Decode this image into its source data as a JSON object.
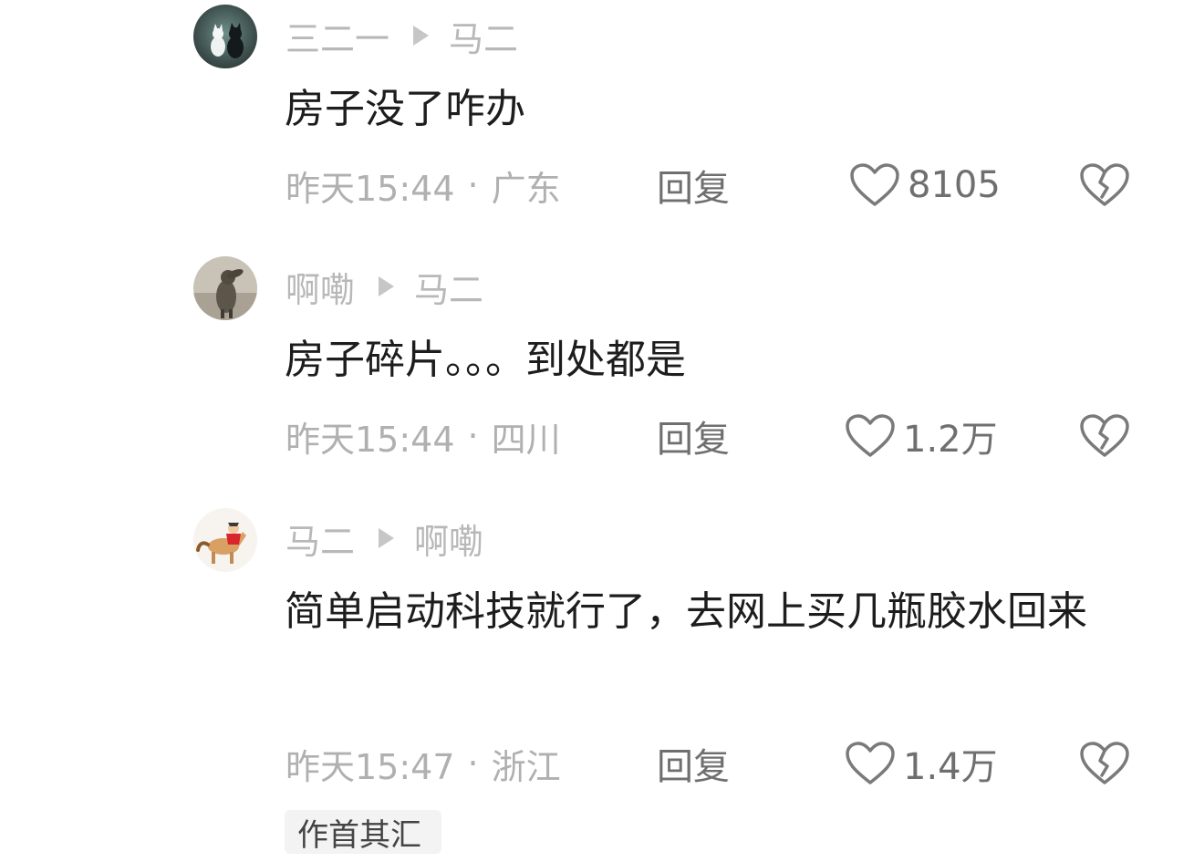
{
  "comments": [
    {
      "author": "三二一",
      "reply_to": "马二",
      "text": "房子没了咋办",
      "time": "昨天15:44",
      "location": "广东",
      "reply_label": "回复",
      "likes": "8105"
    },
    {
      "author": "啊嘞",
      "reply_to": "马二",
      "text": "房子碎片。。。到处都是",
      "time": "昨天15:44",
      "location": "四川",
      "reply_label": "回复",
      "likes": "1.2万"
    },
    {
      "author": "马二",
      "reply_to": "啊嘞",
      "text": "简单启动科技就行了，去网上买几瓶胶水回来",
      "time": "昨天15:47",
      "location": "浙江",
      "reply_label": "回复",
      "likes": "1.4万"
    }
  ],
  "more_replies_label": "作首其汇",
  "icons": {
    "like": "heart-outline-icon",
    "dislike": "broken-heart-icon",
    "reply_arrow": "play-triangle-icon"
  },
  "colors": {
    "username": "#b8b8b8",
    "body_text": "#1d1d1d",
    "meta": "#b0b0b0",
    "action": "#6f6f6f"
  }
}
